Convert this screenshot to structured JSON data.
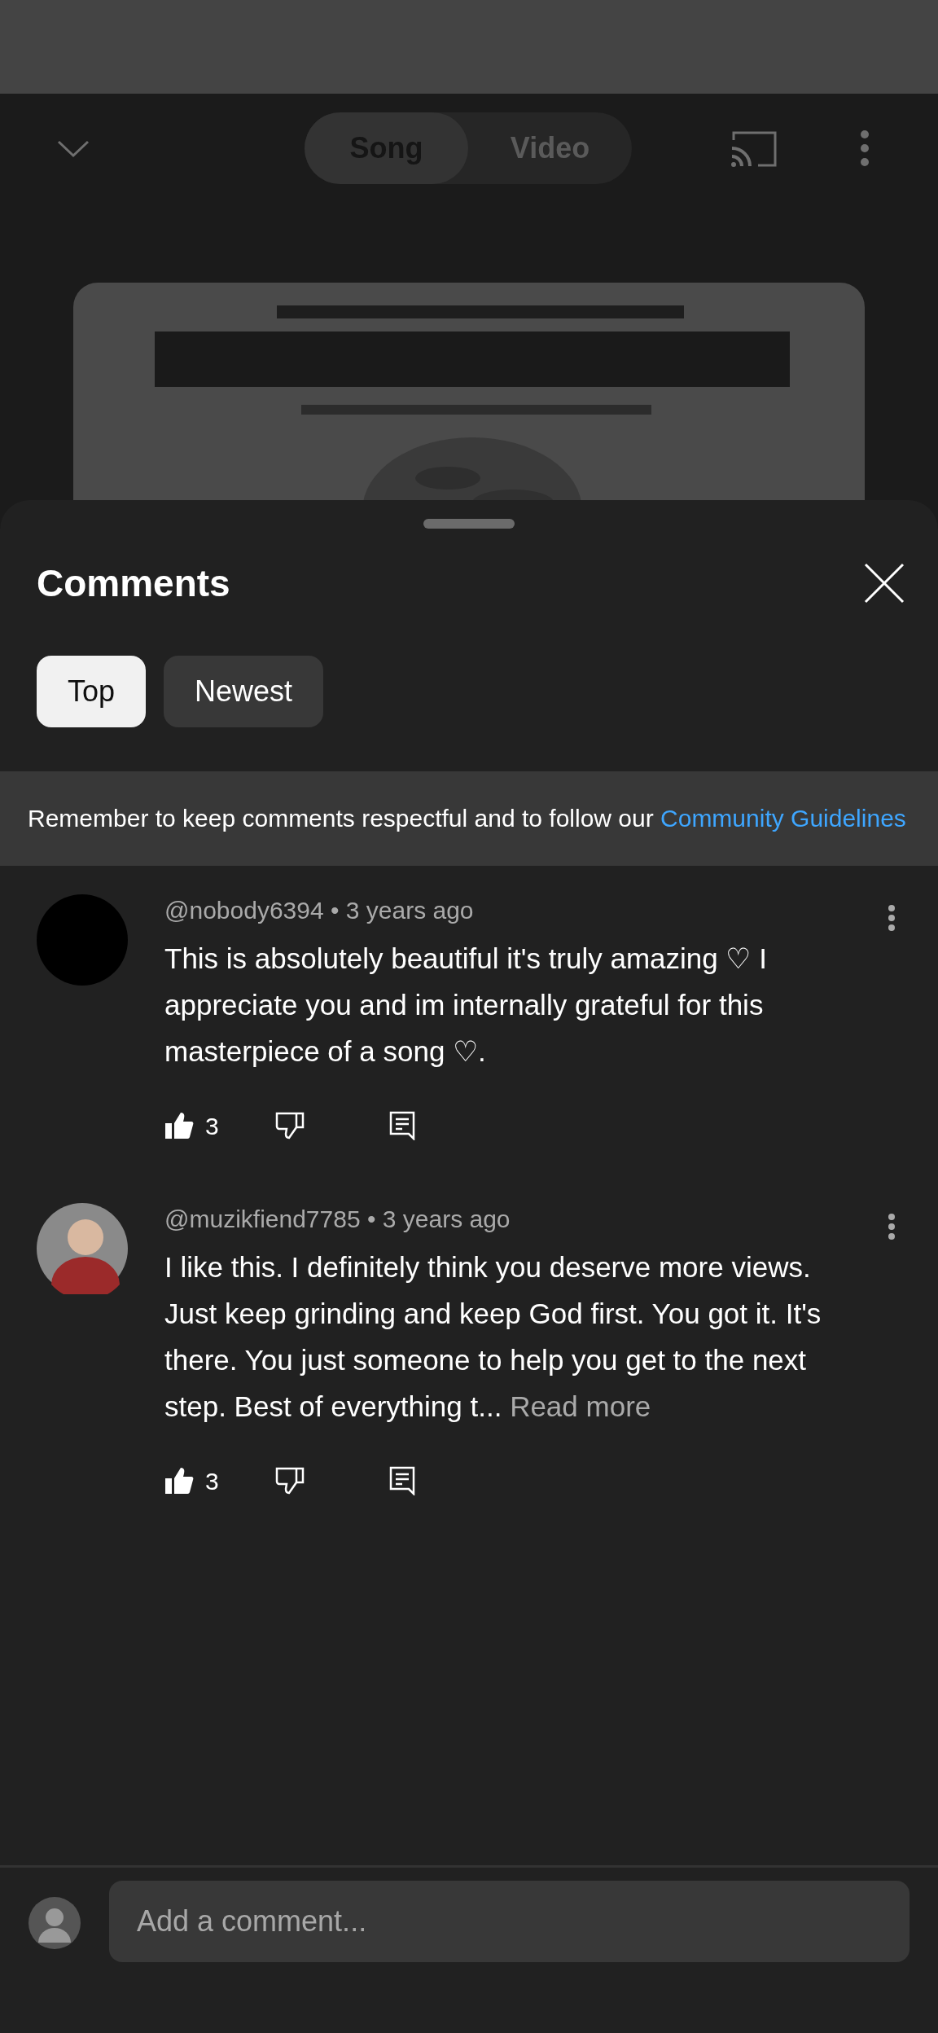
{
  "player_header": {
    "toggle": [
      {
        "label": "Song",
        "selected": true
      },
      {
        "label": "Video",
        "selected": false
      }
    ]
  },
  "comments_sheet": {
    "title": "Comments",
    "filters": [
      {
        "label": "Top",
        "selected": true
      },
      {
        "label": "Newest",
        "selected": false
      }
    ],
    "notice": {
      "text": "Remember to keep comments respectful and to follow our ",
      "link": "Community Guidelines"
    },
    "comments": [
      {
        "byline": "@nobody6394 • 3 years ago",
        "text": "This is absolutely beautiful it's truly amazing ♡ I appreciate you and im internally grateful for this masterpiece of a song ♡.",
        "likes": "3",
        "avatar": {
          "kind": "blank"
        }
      },
      {
        "byline": "@muzikfiend7785 • 3 years ago",
        "text": "I like this. I definitely think you deserve more views. Just keep grinding and keep God first. You got it. It's there. You just someone to help you get to the next step. Best of everything t...",
        "read_more": "Read more",
        "likes": "3"
      }
    ],
    "composer": {
      "placeholder": "Add a comment..."
    }
  }
}
